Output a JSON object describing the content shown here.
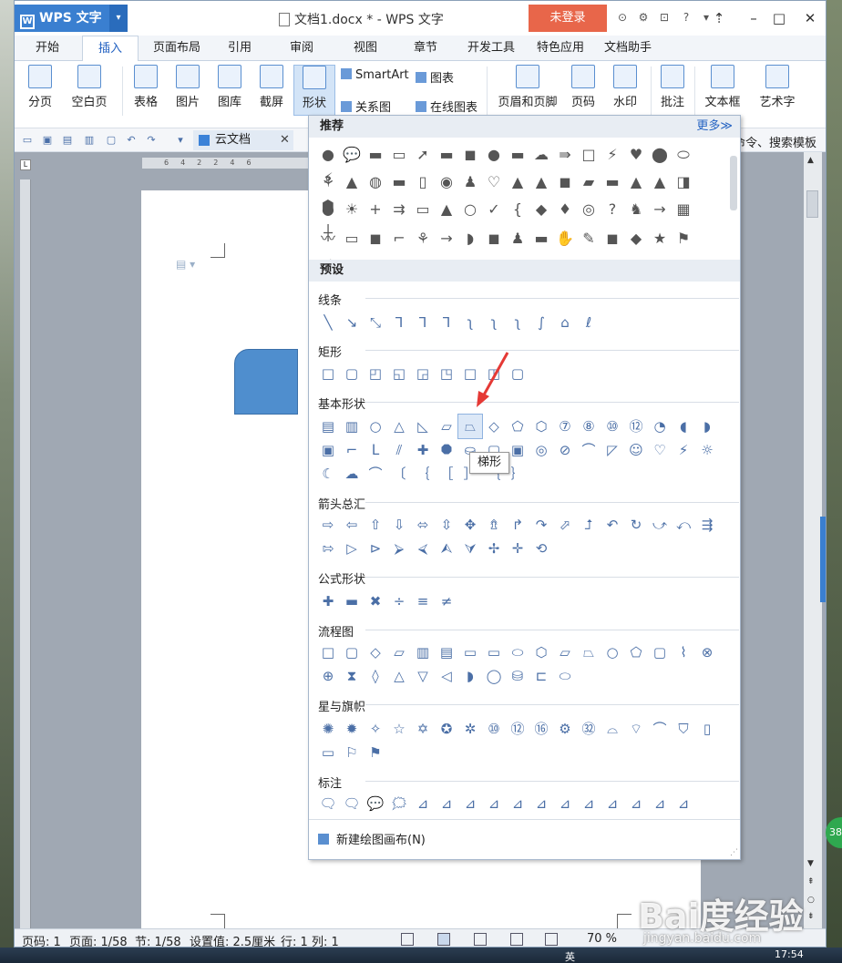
{
  "window": {
    "app_name": "WPS 文字",
    "doc_title": "文档1.docx * - WPS 文字",
    "login_label": "未登录"
  },
  "tabs": [
    {
      "label": "开始"
    },
    {
      "label": "插入"
    },
    {
      "label": "页面布局"
    },
    {
      "label": "引用"
    },
    {
      "label": "审阅"
    },
    {
      "label": "视图"
    },
    {
      "label": "章节"
    },
    {
      "label": "开发工具"
    },
    {
      "label": "特色应用"
    },
    {
      "label": "文档助手"
    }
  ],
  "ribbon": {
    "page_break": "分页",
    "blank_page": "空白页",
    "table": "表格",
    "picture": "图片",
    "gallery": "图库",
    "screenshot": "截屏",
    "shape": "形状",
    "smartart": "SmartArt",
    "chart": "图表",
    "relation": "关系图",
    "online_chart": "在线图表",
    "header_footer": "页眉和页脚",
    "page_number": "页码",
    "watermark": "水印",
    "comment": "批注",
    "textbox": "文本框",
    "wordart": "艺术字"
  },
  "quick_access": {
    "cloud_doc": "云文档",
    "right_text": "线命令、搜索模板"
  },
  "ruler": {
    "h_ticks": "642246"
  },
  "shapes_panel": {
    "recommended_title": "推荐",
    "more_link": "更多≫",
    "preset_title": "预设",
    "sections": [
      {
        "label": "线条"
      },
      {
        "label": "矩形"
      },
      {
        "label": "基本形状"
      },
      {
        "label": "箭头总汇"
      },
      {
        "label": "公式形状"
      },
      {
        "label": "流程图"
      },
      {
        "label": "星与旗帜"
      },
      {
        "label": "标注"
      }
    ],
    "tooltip": "梯形",
    "new_canvas": "新建绘图画布(N)"
  },
  "status": {
    "page_num": "页码: 1",
    "pages": "页面: 1/58",
    "section": "节: 1/58",
    "setting": "设置值: 2.5厘米",
    "row": "行: 1",
    "col": "列: 1",
    "zoom": "70 %"
  },
  "taskbar": {
    "time": "17:54",
    "ime": "英"
  },
  "watermark": {
    "brand": "Bai度经验",
    "site": "jingyan.baidu.com"
  },
  "colors": {
    "accent": "#3a7fd0",
    "login": "#e8664a",
    "shape_fill": "#4f8ece"
  }
}
